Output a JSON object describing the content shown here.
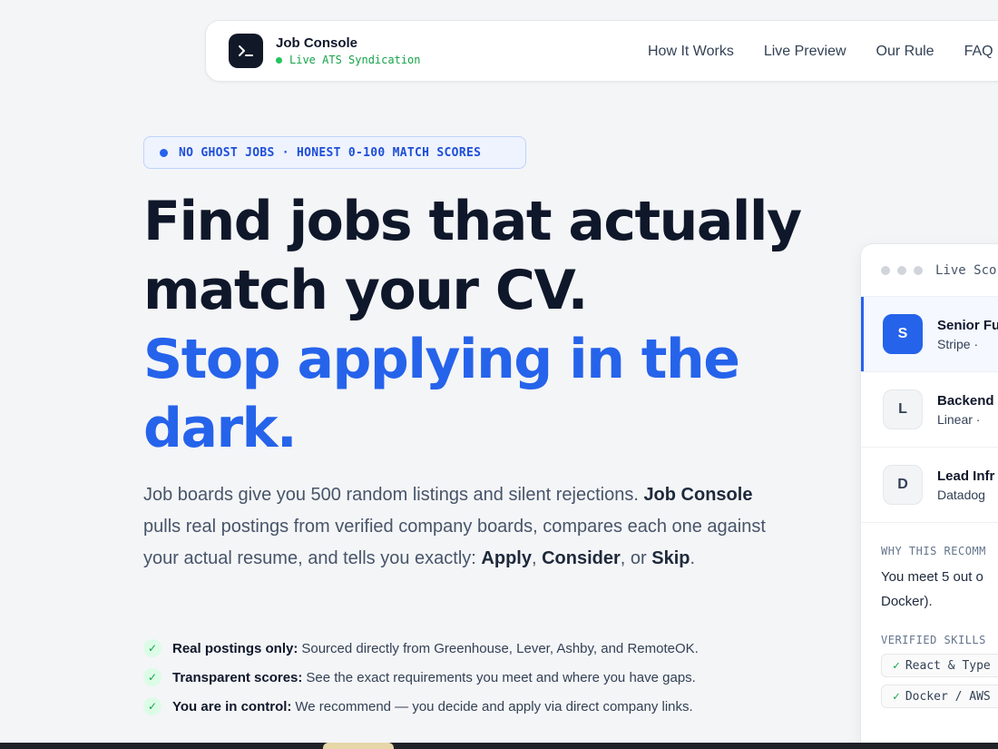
{
  "nav": {
    "brand_title": "Job Console",
    "brand_status": "Live ATS Syndication",
    "links": [
      "How It Works",
      "Live Preview",
      "Our Rule",
      "FAQ"
    ]
  },
  "badge": {
    "text": "NO GHOST JOBS · HONEST 0-100 MATCH SCORES"
  },
  "headline": {
    "line1": "Find jobs that actually",
    "line2": "match your CV.",
    "line3": "Stop applying in the",
    "line4": "dark."
  },
  "lead": {
    "p1": "Job boards give you 500 random listings and silent rejections. ",
    "b1": "Job Console",
    "p2": " pulls real postings from verified company boards, compares each one against your actual resume, and tells you exactly: ",
    "b2": "Apply",
    "p3": ", ",
    "b3": "Consider",
    "p4": ", or ",
    "b4": "Skip",
    "p5": "."
  },
  "checks": [
    {
      "bold": "Real postings only:",
      "text": "Sourced directly from Greenhouse, Lever, Ashby, and RemoteOK."
    },
    {
      "bold": "Transparent scores:",
      "text": "See the exact requirements you meet and where you have gaps."
    },
    {
      "bold": "You are in control:",
      "text": "We recommend — you decide and apply via direct company links."
    }
  ],
  "panel": {
    "title": "Live Sco",
    "jobs": [
      {
        "initial": "S",
        "title": "Senior Fu",
        "company": "Stripe ·"
      },
      {
        "initial": "L",
        "title": "Backend",
        "company": "Linear ·"
      },
      {
        "initial": "D",
        "title": "Lead Infr",
        "company": "Datadog"
      }
    ],
    "why_label": "WHY THIS RECOMM",
    "why_text_1": "You meet 5 out o",
    "why_text_2": "Docker).",
    "skills_label": "VERIFIED SKILLS",
    "skills": [
      "React & Type",
      "Docker / AWS"
    ]
  },
  "colors": {
    "accent": "#2563eb",
    "success": "#16a34a",
    "dark": "#0f172a"
  }
}
